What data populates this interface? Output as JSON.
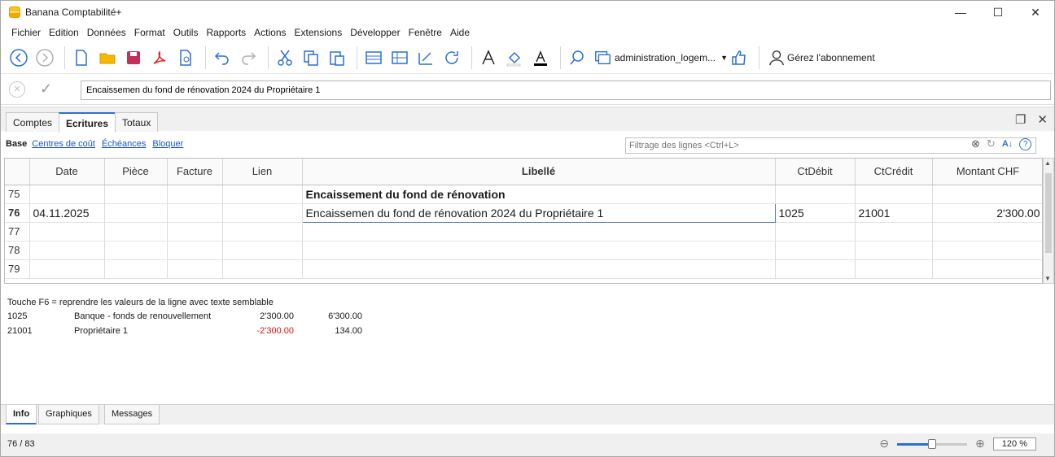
{
  "window": {
    "title": "Banana Comptabilité+",
    "minimize": "—",
    "maximize": "☐",
    "close": "✕"
  },
  "menu": [
    "Fichier",
    "Edition",
    "Données",
    "Format",
    "Outils",
    "Rapports",
    "Actions",
    "Extensions",
    "Développer",
    "Fenêtre",
    "Aide"
  ],
  "toolbar": {
    "document_name": "administration_logem...",
    "subscribe_label": "Gérez l'abonnement",
    "icons": [
      "back-icon",
      "forward-icon",
      "new-file-icon",
      "open-folder-icon",
      "save-icon",
      "pdf-icon",
      "print-preview-icon",
      "undo-icon",
      "redo-icon",
      "cut-icon",
      "copy-icon",
      "paste-icon",
      "insert-row-icon",
      "add-rows-icon",
      "edit-icon",
      "refresh-icon",
      "font-icon",
      "fill-color-icon",
      "text-color-icon",
      "search-icon",
      "window-icon",
      "thumbs-up-icon",
      "user-icon"
    ]
  },
  "editbar": {
    "value": "Encaissemen du fond de rénovation 2024 du Propriétaire 1"
  },
  "tabs": [
    "Comptes",
    "Ecritures",
    "Totaux"
  ],
  "active_tab": "Ecritures",
  "sublinks": {
    "base": "Base",
    "links": [
      "Centres de coût",
      "Échéances",
      "Bloquer"
    ]
  },
  "filter": {
    "placeholder": "Filtrage des lignes <Ctrl+L>"
  },
  "table": {
    "columns": [
      "",
      "Date",
      "Pièce",
      "Facture",
      "Lien",
      "Libellé",
      "CtDébit",
      "CtCrédit",
      "Montant CHF"
    ],
    "rows": [
      {
        "n": "75",
        "date": "",
        "piece": "",
        "facture": "",
        "lien": "",
        "libelle": "Encaissement du fond de rénovation",
        "debit": "",
        "credit": "",
        "montant": "",
        "bold": true
      },
      {
        "n": "76",
        "date": "04.11.2025",
        "piece": "",
        "facture": "",
        "lien": "",
        "libelle": "Encaissemen du fond de rénovation 2024 du Propriétaire 1",
        "debit": "1025",
        "credit": "21001",
        "montant": "2'300.00",
        "current": true
      },
      {
        "n": "77",
        "date": "",
        "piece": "",
        "facture": "",
        "lien": "",
        "libelle": "",
        "debit": "",
        "credit": "",
        "montant": ""
      },
      {
        "n": "78",
        "date": "",
        "piece": "",
        "facture": "",
        "lien": "",
        "libelle": "",
        "debit": "",
        "credit": "",
        "montant": ""
      },
      {
        "n": "79",
        "date": "",
        "piece": "",
        "facture": "",
        "lien": "",
        "libelle": "",
        "debit": "",
        "credit": "",
        "montant": ""
      }
    ]
  },
  "info": {
    "hint": "Touche F6 = reprendre les valeurs de la ligne avec texte semblable",
    "lines": [
      {
        "account": "1025",
        "desc": "Banque - fonds de renouvellement",
        "amount": "2'300.00",
        "balance": "6'300.00",
        "negative": false
      },
      {
        "account": "21001",
        "desc": "Propriétaire 1",
        "amount": "-2'300.00",
        "balance": "134.00",
        "negative": true
      }
    ]
  },
  "bottom_tabs": [
    "Info",
    "Graphiques",
    "Messages"
  ],
  "status": {
    "position": "76 / 83",
    "zoom": "120 %",
    "zoom_level": 0.5
  },
  "colors": {
    "accent": "#2b6fd6",
    "negative": "#e01010",
    "link": "#1a55c4"
  }
}
